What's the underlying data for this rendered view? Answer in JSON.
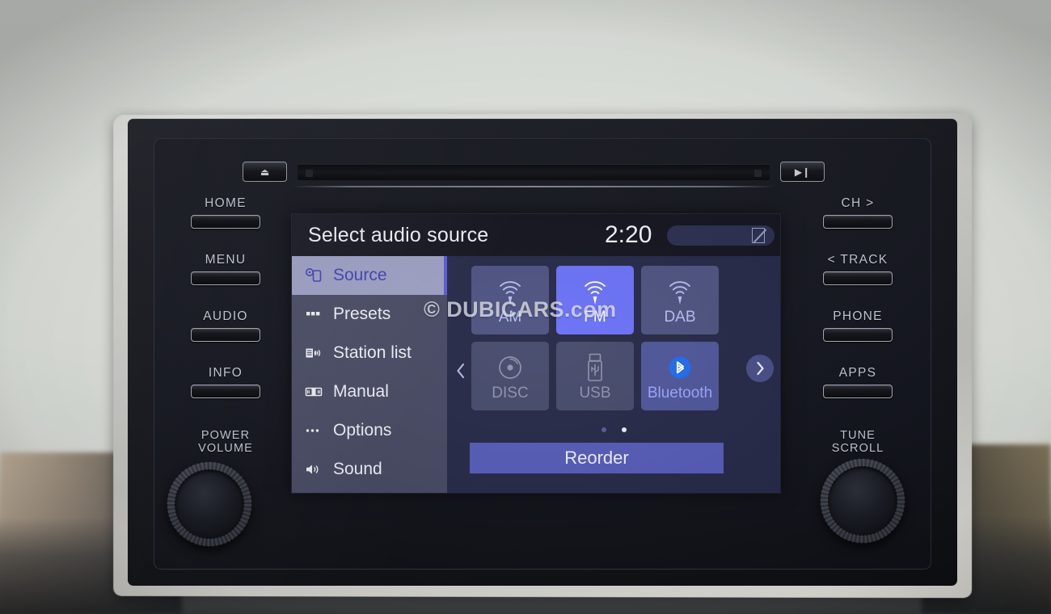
{
  "device": {
    "name": "car-infotainment-head-unit",
    "hardkeys_left": [
      {
        "label": "HOME",
        "name": "home"
      },
      {
        "label": "MENU",
        "name": "menu"
      },
      {
        "label": "AUDIO",
        "name": "audio"
      },
      {
        "label": "INFO",
        "name": "info"
      }
    ],
    "hardkeys_right": [
      {
        "label": "CH  >",
        "name": "ch-next"
      },
      {
        "label": "< TRACK",
        "name": "track-prev"
      },
      {
        "label": "PHONE",
        "name": "phone"
      },
      {
        "label": "APPS",
        "name": "apps"
      }
    ],
    "knob_left": {
      "line1": "POWER",
      "line2": "VOLUME"
    },
    "knob_right": {
      "line1": "TUNE",
      "line2": "SCROLL"
    },
    "cd_controls": {
      "eject": "⏏",
      "play_pause": "▶❙"
    }
  },
  "screen": {
    "title": "Select audio source",
    "clock": "2:20",
    "status_icon": "no-signal-icon",
    "sidebar": {
      "items": [
        {
          "label": "Source",
          "icon": "source-icon",
          "selected": true
        },
        {
          "label": "Presets",
          "icon": "presets-icon",
          "selected": false
        },
        {
          "label": "Station list",
          "icon": "station-list-icon",
          "selected": false
        },
        {
          "label": "Manual",
          "icon": "manual-icon",
          "selected": false
        },
        {
          "label": "Options",
          "icon": "options-icon",
          "selected": false
        },
        {
          "label": "Sound",
          "icon": "sound-icon",
          "selected": false
        }
      ]
    },
    "sources": [
      {
        "label": "AM",
        "icon": "radio-waves-icon",
        "state": "available"
      },
      {
        "label": "FM",
        "icon": "radio-waves-icon",
        "state": "active"
      },
      {
        "label": "DAB",
        "icon": "radio-waves-icon",
        "state": "available"
      },
      {
        "label": "DISC",
        "icon": "disc-icon",
        "state": "disabled"
      },
      {
        "label": "USB",
        "icon": "usb-icon",
        "state": "disabled"
      },
      {
        "label": "Bluetooth",
        "icon": "bluetooth-icon",
        "state": "bt"
      }
    ],
    "pagination": {
      "pages": 2,
      "current": 2
    },
    "reorder_label": "Reorder",
    "nav": {
      "prev": "‹",
      "next": "›"
    },
    "watermark": "© DUBICARS.com"
  },
  "colors": {
    "screen_bg": "#262a48",
    "sidebar_bg": "#474a63",
    "selected_bg": "#9da0c4",
    "selected_text": "#3f3fb8",
    "tile_bg": "#4e5481",
    "tile_active": "#6b72f7",
    "tile_disabled": "#474b6c",
    "bluetooth_blue": "#1f6df0",
    "reorder_bg": "#575db9"
  }
}
